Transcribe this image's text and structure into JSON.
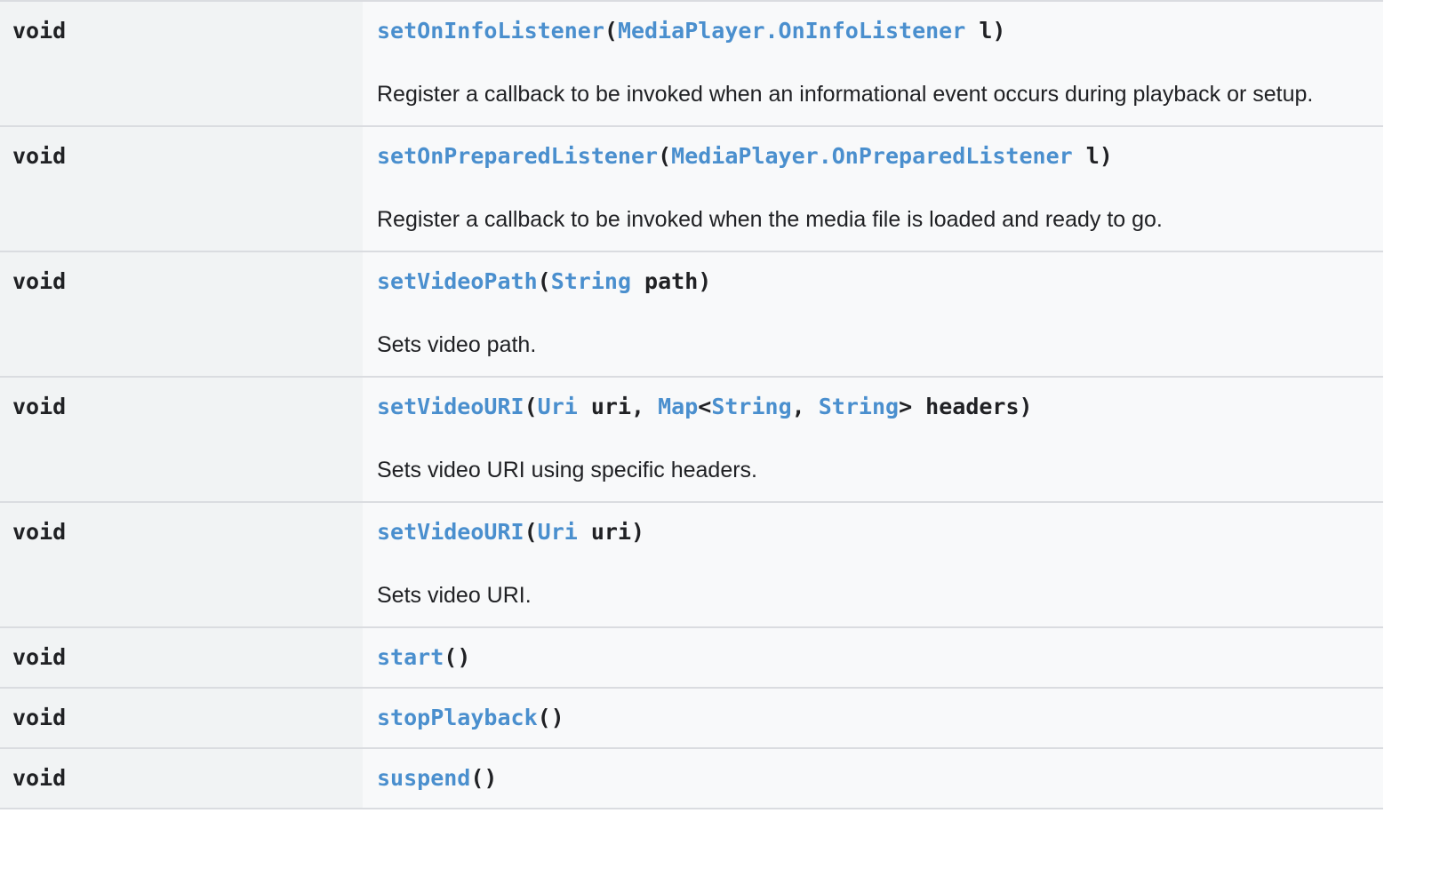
{
  "colors": {
    "link": "#4a8fce",
    "text": "#202124",
    "type_cell_bg": "#f1f3f4",
    "desc_cell_bg": "#f8f9fa",
    "divider": "#dadce0"
  },
  "rows": [
    {
      "return_type": "void",
      "signature": [
        {
          "t": "setOnInfoListener",
          "link": true
        },
        {
          "t": "(",
          "link": false
        },
        {
          "t": "MediaPlayer.OnInfoListener",
          "link": true
        },
        {
          "t": " l)",
          "link": false
        }
      ],
      "description": "Register a callback to be invoked when an informational event occurs during playback or setup."
    },
    {
      "return_type": "void",
      "signature": [
        {
          "t": "setOnPreparedListener",
          "link": true
        },
        {
          "t": "(",
          "link": false
        },
        {
          "t": "MediaPlayer.OnPreparedListener",
          "link": true
        },
        {
          "t": " l)",
          "link": false
        }
      ],
      "description": "Register a callback to be invoked when the media file is loaded and ready to go."
    },
    {
      "return_type": "void",
      "signature": [
        {
          "t": "setVideoPath",
          "link": true
        },
        {
          "t": "(",
          "link": false
        },
        {
          "t": "String",
          "link": true
        },
        {
          "t": " path)",
          "link": false
        }
      ],
      "description": "Sets video path."
    },
    {
      "return_type": "void",
      "signature": [
        {
          "t": "setVideoURI",
          "link": true
        },
        {
          "t": "(",
          "link": false
        },
        {
          "t": "Uri",
          "link": true
        },
        {
          "t": " uri, ",
          "link": false
        },
        {
          "t": "Map",
          "link": true
        },
        {
          "t": "<",
          "link": false
        },
        {
          "t": "String",
          "link": true
        },
        {
          "t": ", ",
          "link": false
        },
        {
          "t": "String",
          "link": true
        },
        {
          "t": "> headers)",
          "link": false
        }
      ],
      "description": "Sets video URI using specific headers."
    },
    {
      "return_type": "void",
      "signature": [
        {
          "t": "setVideoURI",
          "link": true
        },
        {
          "t": "(",
          "link": false
        },
        {
          "t": "Uri",
          "link": true
        },
        {
          "t": " uri)",
          "link": false
        }
      ],
      "description": "Sets video URI."
    },
    {
      "return_type": "void",
      "signature": [
        {
          "t": "start",
          "link": true
        },
        {
          "t": "()",
          "link": false
        }
      ],
      "description": ""
    },
    {
      "return_type": "void",
      "signature": [
        {
          "t": "stopPlayback",
          "link": true
        },
        {
          "t": "()",
          "link": false
        }
      ],
      "description": ""
    },
    {
      "return_type": "void",
      "signature": [
        {
          "t": "suspend",
          "link": true
        },
        {
          "t": "()",
          "link": false
        }
      ],
      "description": ""
    }
  ]
}
